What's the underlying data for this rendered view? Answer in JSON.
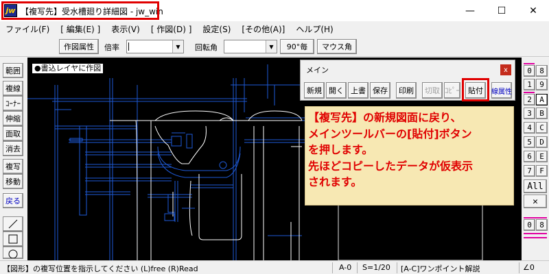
{
  "window": {
    "app_icon_text": "jw",
    "title": "【複写先】受水槽廻り詳細図 - jw_win",
    "minimize_glyph": "—",
    "maximize_glyph": "☐",
    "close_glyph": "✕"
  },
  "menu": [
    "ファイル(F)",
    "[ 編集(E) ]",
    "表示(V)",
    "[ 作図(D) ]",
    "設定(S)",
    "[その他(A)]",
    "ヘルプ(H)"
  ],
  "toolbar": {
    "draw_attr_label": "作図属性",
    "scale_label": "倍率",
    "scale_value": "",
    "rotate_label": "回転角",
    "rotate_value": "",
    "deg90_label": "90°毎",
    "mouse_angle_label": "マウス角"
  },
  "left_tools": [
    "範囲",
    "複線",
    "ｺｰﾅｰ",
    "伸縮",
    "面取",
    "消去",
    "複写",
    "移動",
    "戻る"
  ],
  "left_shapes": [
    "line-tool-icon",
    "rectangle-tool-icon",
    "circle-tool-icon"
  ],
  "canvas": {
    "layer_label": "●書込レイヤに作図"
  },
  "main_toolbar": {
    "title": "メイン",
    "close_glyph": "x",
    "buttons": {
      "new": "新規",
      "open": "開く",
      "overwrite": "上書",
      "save": "保存",
      "print": "印刷",
      "cut": "切取",
      "copy": "ｺﾋﾟｰ",
      "paste": "貼付",
      "line_attr": "線属性"
    }
  },
  "callout": {
    "lines": [
      "【複写先】の新規図面に戻り、",
      "メインツールバーの[貼付]ボタン",
      "を押します。",
      "先ほどコピーしたデータが仮表示",
      "されます。"
    ]
  },
  "right_panel": {
    "grid": [
      [
        "0",
        "8"
      ],
      [
        "1",
        "9"
      ],
      [
        "2",
        "A"
      ],
      [
        "3",
        "B"
      ],
      [
        "4",
        "C"
      ],
      [
        "5",
        "D"
      ],
      [
        "6",
        "E"
      ],
      [
        "7",
        "F"
      ]
    ],
    "all_label": "All",
    "x_label": "✕",
    "bottom": [
      "0",
      "8"
    ]
  },
  "status": {
    "message": "【図形】の複写位置を指示してください (L)free (R)Read",
    "layer": "A-0",
    "scale": "S=1/20",
    "help": "[A-C]ワンポイント解説",
    "angle": "∠0"
  },
  "colors": {
    "highlight_red": "#e00000",
    "callout_bg": "#f7e8b3",
    "drawing_blue": "#1e5ad8",
    "drawing_white": "#ffffff",
    "canvas_bg": "#000000"
  }
}
